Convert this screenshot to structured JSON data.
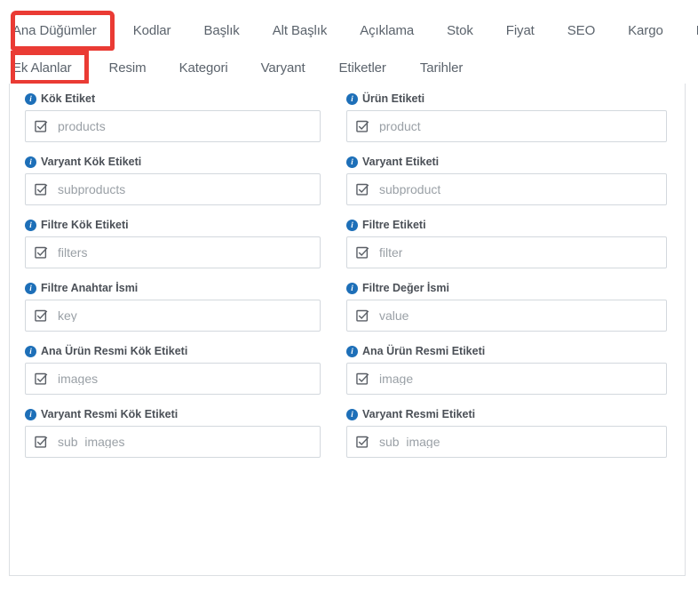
{
  "tabs": {
    "row1": [
      {
        "label": "Ana Düğümler",
        "active": true
      },
      {
        "label": "Kodlar",
        "active": false
      },
      {
        "label": "Başlık",
        "active": false
      },
      {
        "label": "Alt Başlık",
        "active": false
      },
      {
        "label": "Açıklama",
        "active": false
      },
      {
        "label": "Stok",
        "active": false
      },
      {
        "label": "Fiyat",
        "active": false
      },
      {
        "label": "SEO",
        "active": false
      },
      {
        "label": "Kargo",
        "active": false
      },
      {
        "label": "Diğer",
        "active": false
      }
    ],
    "row2": [
      {
        "label": "Ek Alanlar",
        "active": true
      },
      {
        "label": "Resim",
        "active": false
      },
      {
        "label": "Kategori",
        "active": false
      },
      {
        "label": "Varyant",
        "active": false
      },
      {
        "label": "Etiketler",
        "active": false
      },
      {
        "label": "Tarihler",
        "active": false
      }
    ]
  },
  "annotations": {
    "color": "#ea3b34",
    "highlighted_tabs": [
      "Ana Düğümler",
      "Ek Alanlar"
    ]
  },
  "form": {
    "info_icon_glyph": "i",
    "input_prefix_icon": "check-square-icon",
    "rows": [
      {
        "left": {
          "label": "Kök Etiket",
          "value": "products"
        },
        "right": {
          "label": "Ürün Etiketi",
          "value": "product"
        }
      },
      {
        "left": {
          "label": "Varyant Kök Etiketi",
          "value": "subproducts"
        },
        "right": {
          "label": "Varyant Etiketi",
          "value": "subproduct"
        }
      },
      {
        "left": {
          "label": "Filtre Kök Etiketi",
          "value": "filters"
        },
        "right": {
          "label": "Filtre Etiketi",
          "value": "filter"
        }
      },
      {
        "left": {
          "label": "Filtre Anahtar İsmi",
          "value": "key"
        },
        "right": {
          "label": "Filtre Değer İsmi",
          "value": "value"
        }
      },
      {
        "left": {
          "label": "Ana Ürün Resmi Kök Etiketi",
          "value": "images"
        },
        "right": {
          "label": "Ana Ürün Resmi Etiketi",
          "value": "image"
        }
      },
      {
        "left": {
          "label": "Varyant Resmi Kök Etiketi",
          "value": "sub_images"
        },
        "right": {
          "label": "Varyant Resmi Etiketi",
          "value": "sub_image"
        }
      }
    ]
  },
  "colors": {
    "accent_red": "#ea3b34",
    "info_blue": "#1d6fb8",
    "border_gray": "#dcdfe3",
    "placeholder_gray": "#9aa0a6",
    "tab_text": "#5b636c"
  }
}
